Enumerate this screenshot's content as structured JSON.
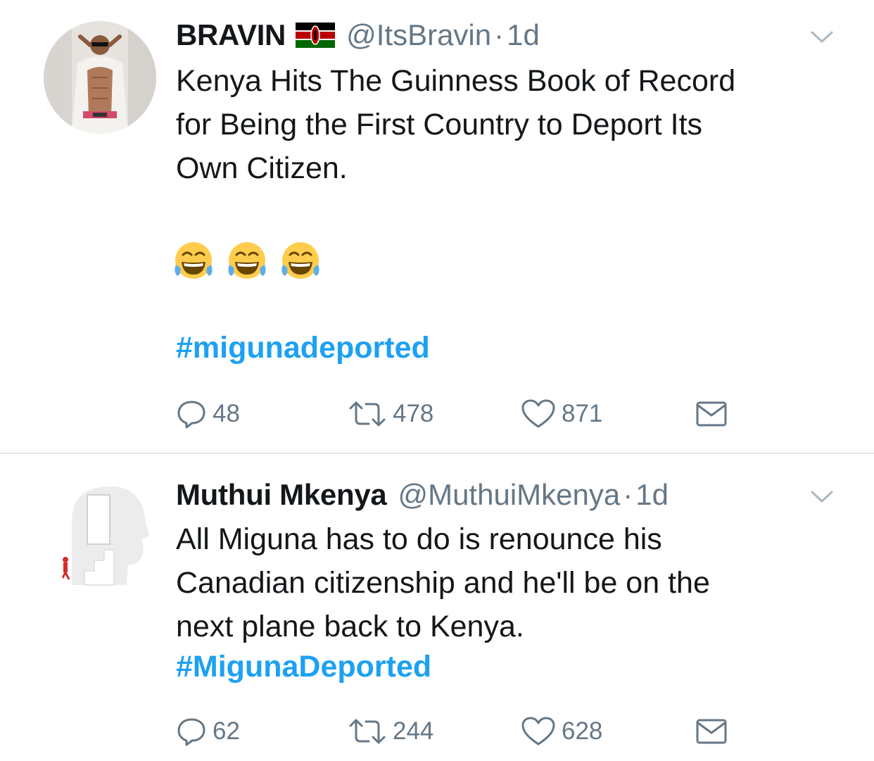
{
  "tweets": [
    {
      "author": "BRAVIN",
      "handle": "@ItsBravin",
      "separator": "·",
      "time": "1d",
      "text_lines": [
        "Kenya Hits The Guinness Book of Record",
        "for Being the First Country to Deport Its",
        "Own Citizen."
      ],
      "emojis": [
        "face-with-tears-of-joy-icon",
        "face-with-tears-of-joy-icon",
        "face-with-tears-of-joy-icon"
      ],
      "hashtag": "#migunadeported",
      "replies": "48",
      "retweets": "478",
      "likes": "871"
    },
    {
      "author": "Muthui Mkenya",
      "handle": "@MuthuiMkenya",
      "separator": "·",
      "time": "1d",
      "text_lines": [
        "All Miguna has to do is renounce his",
        "Canadian citizenship and he'll be on the",
        "next plane back to Kenya."
      ],
      "hashtag": "#MigunaDeported",
      "replies": "62",
      "retweets": "244",
      "likes": "628"
    }
  ],
  "colors": {
    "text": "#14171a",
    "secondary": "#657786",
    "link": "#1da1f2",
    "divider": "#e1e8ed",
    "icon": "#657786"
  }
}
